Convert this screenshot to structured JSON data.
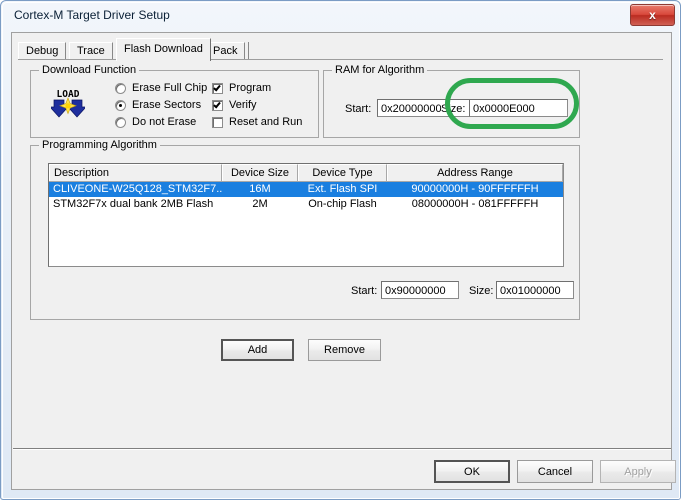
{
  "window": {
    "title": "Cortex-M Target Driver Setup",
    "close_label": "x",
    "close_icon": "close-icon"
  },
  "tabs": [
    {
      "label": "Debug",
      "active": false
    },
    {
      "label": "Trace",
      "active": false
    },
    {
      "label": "Flash Download",
      "active": true
    },
    {
      "label": "Pack",
      "active": false
    }
  ],
  "download_function": {
    "title": "Download Function",
    "icon": "load-flash-icon",
    "icon_text": "LOAD",
    "radios": [
      {
        "label": "Erase Full Chip",
        "selected": false
      },
      {
        "label": "Erase Sectors",
        "selected": true
      },
      {
        "label": "Do not Erase",
        "selected": false
      }
    ],
    "checkboxes": [
      {
        "label": "Program",
        "checked": true
      },
      {
        "label": "Verify",
        "checked": true
      },
      {
        "label": "Reset and Run",
        "checked": false
      }
    ]
  },
  "ram_for_algorithm": {
    "title": "RAM for Algorithm",
    "start_label": "Start:",
    "start_value": "0x20000000",
    "size_label": "Size:",
    "size_value": "0x0000E000"
  },
  "programming_algorithm": {
    "title": "Programming Algorithm",
    "columns": [
      "Description",
      "Device Size",
      "Device Type",
      "Address Range"
    ],
    "rows": [
      {
        "description": "CLIVEONE-W25Q128_STM32F7...",
        "device_size": "16M",
        "device_type": "Ext. Flash SPI",
        "address_range": "90000000H - 90FFFFFFH",
        "selected": true
      },
      {
        "description": "STM32F7x dual bank 2MB Flash",
        "device_size": "2M",
        "device_type": "On-chip Flash",
        "address_range": "08000000H - 081FFFFFH",
        "selected": false
      }
    ],
    "start_label": "Start:",
    "start_value": "0x90000000",
    "size_label": "Size:",
    "size_value": "0x01000000"
  },
  "buttons": {
    "add": "Add",
    "remove": "Remove",
    "ok": "OK",
    "cancel": "Cancel",
    "apply": "Apply"
  },
  "annotation": {
    "shape": "oval-highlight",
    "color": "#2fa84f",
    "target": "ram-size-field"
  },
  "colors": {
    "selection_blue": "#1a7fe0",
    "dialog_bg": "#f0f0f0",
    "close_red": "#d9483b",
    "annotation_green": "#2fa84f"
  }
}
